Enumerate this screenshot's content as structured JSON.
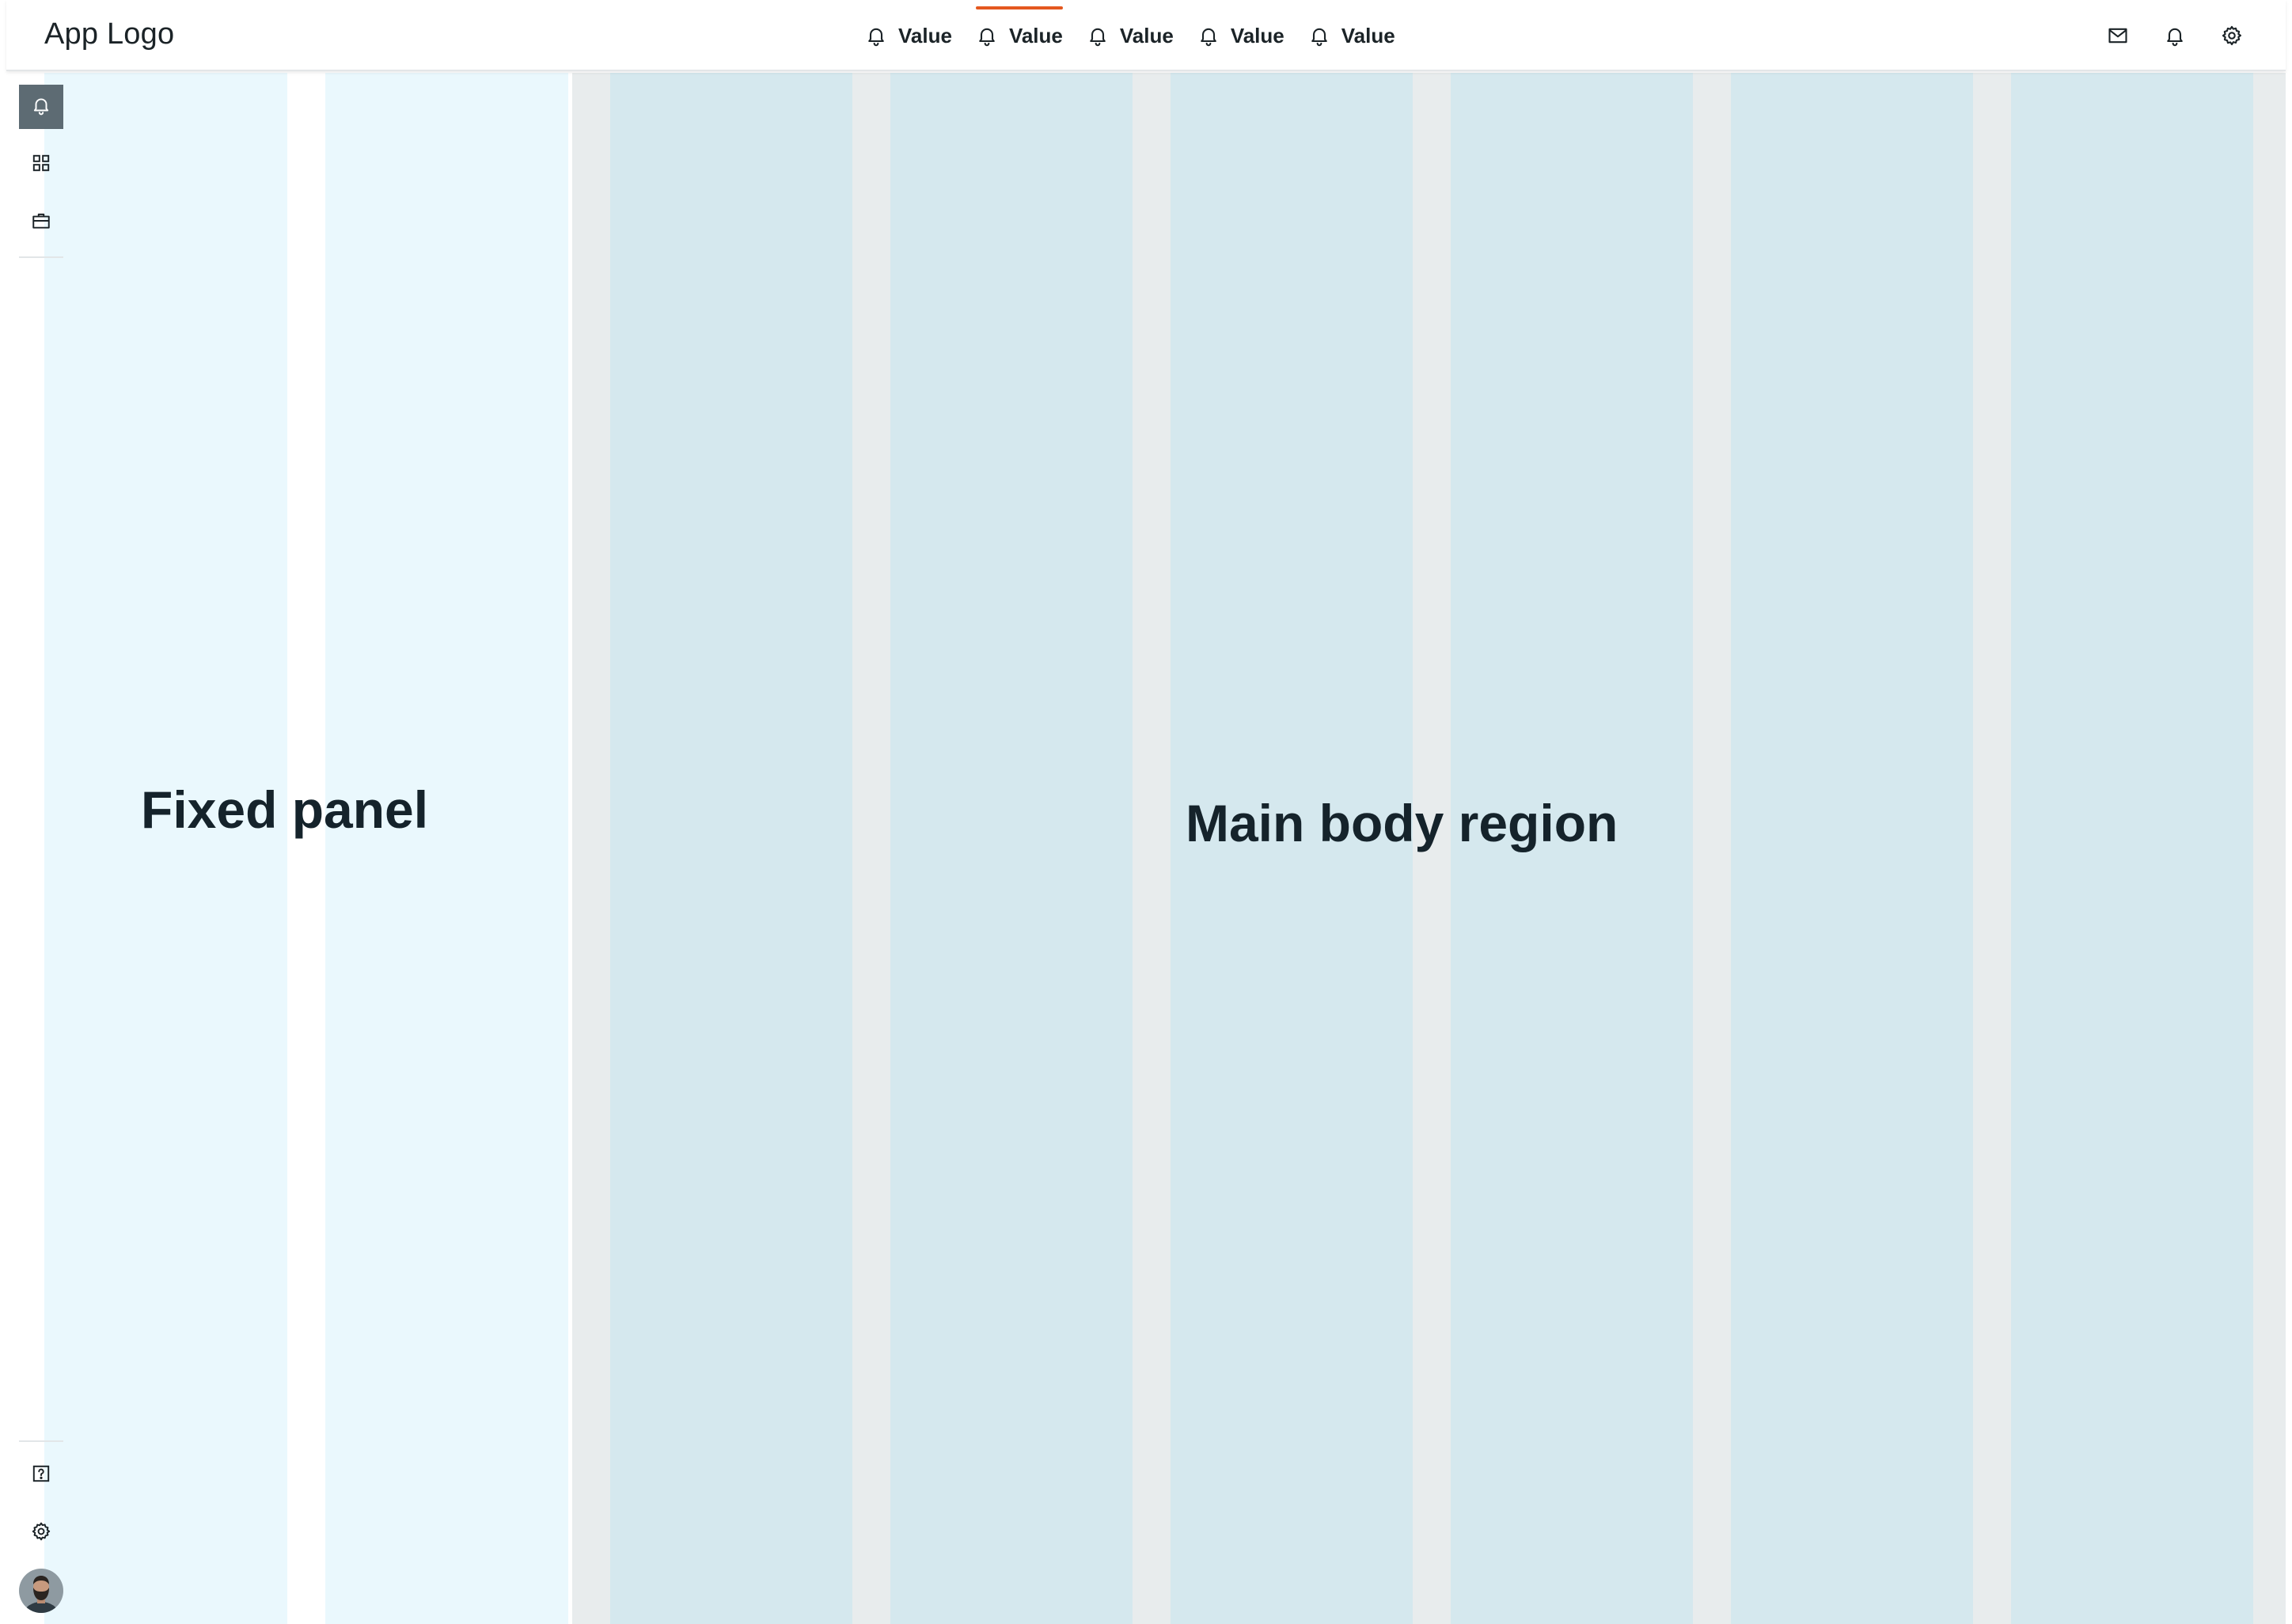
{
  "header": {
    "logo": "App Logo",
    "tabs": [
      {
        "label": "Value",
        "icon": "bell-icon",
        "active": false
      },
      {
        "label": "Value",
        "icon": "bell-icon",
        "active": true
      },
      {
        "label": "Value",
        "icon": "bell-icon",
        "active": false
      },
      {
        "label": "Value",
        "icon": "bell-icon",
        "active": false
      },
      {
        "label": "Value",
        "icon": "bell-icon",
        "active": false
      }
    ],
    "actions": [
      "mail-icon",
      "bell-icon",
      "gear-icon"
    ]
  },
  "sidebar": {
    "top_items": [
      {
        "icon": "bell-icon",
        "active": true
      },
      {
        "icon": "grid-icon",
        "active": false
      },
      {
        "icon": "briefcase-icon",
        "active": false
      }
    ],
    "bottom_items": [
      {
        "icon": "help-icon"
      },
      {
        "icon": "gear-icon"
      },
      {
        "icon": "avatar"
      }
    ]
  },
  "layout_labels": {
    "fixed_panel": "Fixed panel",
    "main_body": "Main body region"
  },
  "colors": {
    "accent": "#e4581f",
    "active_rail": "#5d6b73",
    "fixed_column": "#eaf8fd",
    "main_column": "#d5e8ee",
    "main_gutter": "#e8eced",
    "text": "#15232b"
  }
}
